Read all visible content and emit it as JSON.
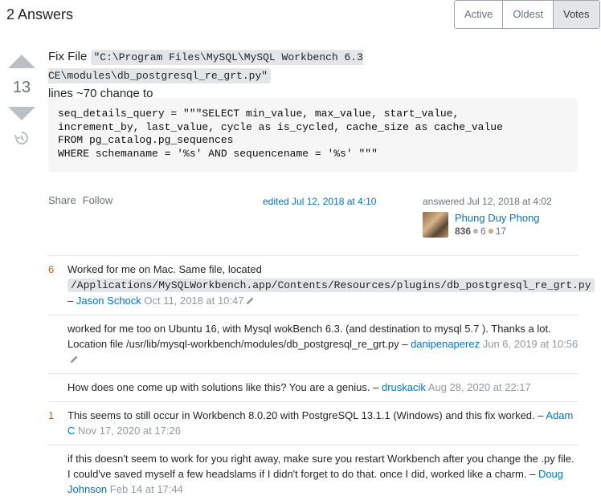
{
  "header": {
    "answer_count": "2 Answers"
  },
  "sort": {
    "options": [
      "Active",
      "Oldest",
      "Votes"
    ],
    "selected": "Votes"
  },
  "vote": {
    "count": "13"
  },
  "post": {
    "intro": "Fix File ",
    "file_path": "\"C:\\Program Files\\MySQL\\MySQL Workbench 6.3 CE\\modules\\db_postgresql_re_grt.py\"",
    "line_note": "lines ~70 change to",
    "code": "seq_details_query = \"\"\"SELECT min_value, max_value, start_value,\nincrement_by, last_value, cycle as is_cycled, cache_size as cache_value\nFROM pg_catalog.pg_sequences\nWHERE schemaname = '%s' AND sequencename = '%s' \"\"\""
  },
  "menu": {
    "share": "Share",
    "follow": "Follow"
  },
  "edited": "edited Jul 12, 2018 at 4:10",
  "answered": {
    "label": "answered Jul 12, 2018 at 4:02",
    "user": "Phung Duy Phong",
    "reputation": "836",
    "silver": "6",
    "bronze": "17"
  },
  "comments": [
    {
      "score": "6",
      "text_before": "Worked for me on Mac. Same file, located ",
      "code": "/Applications/MySQLWorkbench.app/Contents/Resources/plugins/db_postgresql_re_grt.py",
      "text_after": " – ",
      "user": "Jason Schock",
      "date": "Oct 11, 2018 at 10:47",
      "edited": true
    },
    {
      "score": "",
      "text_before": "worked for me too on Ubuntu 16, with Mysql wokBench 6.3. (and destination to mysql 5.7 ). Thanks a lot. Location file /usr/lib/mysql-workbench/modules/db_postgresql_re_grt.py – ",
      "code": "",
      "text_after": "",
      "user": "danipenaperez",
      "date": "Jun 6, 2019 at 10:56",
      "edited": true
    },
    {
      "score": "",
      "text_before": "How does one come up with solutions like this? You are a genius. – ",
      "code": "",
      "text_after": "",
      "user": "druskacik",
      "date": "Aug 28, 2020 at 22:17",
      "edited": false
    },
    {
      "score": "1",
      "text_before": "This seems to still occur in Workbench 8.0.20 with PostgreSQL 13.1.1 (Windows) and this fix worked. – ",
      "code": "",
      "text_after": "",
      "user": "Adam C",
      "date": "Nov 17, 2020 at 17:26",
      "edited": false
    },
    {
      "score": "",
      "text_before": "if this doesn't seem to work for you right away, make sure you restart Workbench after you change the .py file. I could've saved myself a few headslams if I didn't forget to do that. once I did, worked like a charm. – ",
      "code": "",
      "text_after": "",
      "user": "Doug Johnson",
      "date": "Feb 14 at 17:44",
      "edited": false
    }
  ],
  "colors": {
    "link": "#0074cc",
    "score": "#c75f19",
    "silver_badge": "#b4b8bc",
    "bronze_badge": "#d1a684"
  }
}
